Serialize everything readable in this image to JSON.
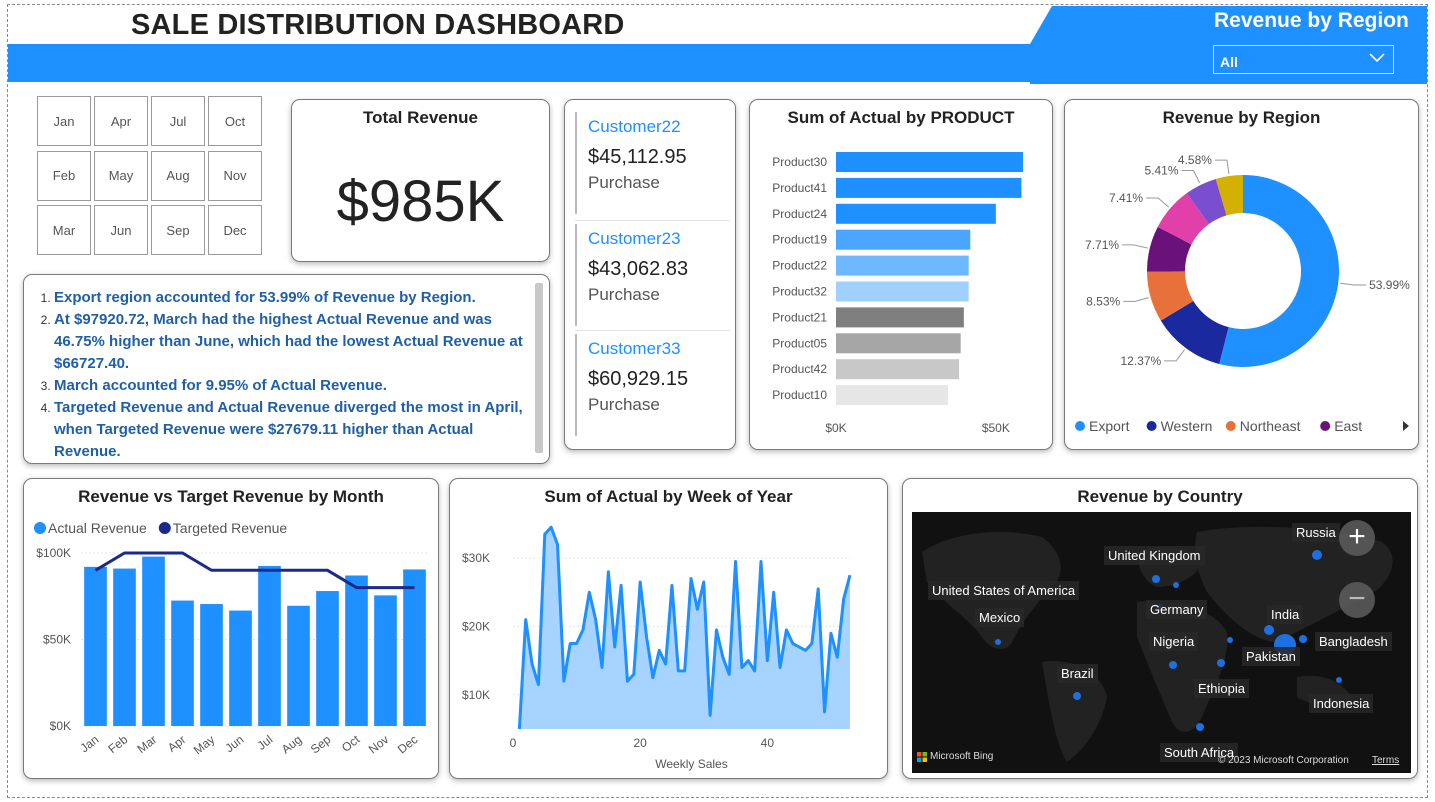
{
  "header": {
    "title": "SALE DISTRIBUTION DASHBOARD",
    "slicer_title": "Revenue by Region",
    "slicer_value": "All"
  },
  "months": [
    "Jan",
    "Apr",
    "Jul",
    "Oct",
    "Feb",
    "May",
    "Aug",
    "Nov",
    "Mar",
    "Jun",
    "Sep",
    "Dec"
  ],
  "total_revenue": {
    "title": "Total Revenue",
    "value": "$985K"
  },
  "narrative": [
    "Export region accounted for 53.99% of Revenue by Region.",
    "At $97920.72, March had the highest Actual Revenue and was 46.75% higher than June, which had the lowest Actual Revenue at $66727.40.",
    "March accounted for 9.95% of Actual Revenue.",
    "Targeted Revenue and Actual Revenue diverged the most in April, when Targeted Revenue were $27679.11 higher than Actual Revenue."
  ],
  "customers": [
    {
      "name": "Customer22",
      "value": "$45,112.95",
      "label": "Purchase"
    },
    {
      "name": "Customer23",
      "value": "$43,062.83",
      "label": "Purchase"
    },
    {
      "name": "Customer33",
      "value": "$60,929.15",
      "label": "Purchase"
    }
  ],
  "colors": {
    "accent": "#1e90ff",
    "navy": "#1a2a8a"
  },
  "chart_data": [
    {
      "id": "product",
      "type": "bar",
      "orientation": "horizontal",
      "title": "Sum of Actual by PRODUCT",
      "categories": [
        "Product30",
        "Product41",
        "Product24",
        "Product19",
        "Product22",
        "Product32",
        "Product21",
        "Product05",
        "Product42",
        "Product10"
      ],
      "values": [
        58500,
        58000,
        50000,
        42000,
        41500,
        41500,
        40000,
        39000,
        38500,
        35000
      ],
      "colors": [
        "#1e90ff",
        "#1e90ff",
        "#1e90ff",
        "#4aa6ff",
        "#6db8ff",
        "#9fd0ff",
        "#7f7f7f",
        "#a6a6a6",
        "#c8c8c8",
        "#e6e6e6"
      ],
      "xlim": [
        0,
        58500
      ],
      "xticks": [
        {
          "v": 0,
          "label": "$0K"
        },
        {
          "v": 50000,
          "label": "$50K"
        }
      ]
    },
    {
      "id": "region",
      "type": "pie",
      "title": "Revenue by Region",
      "labels": [
        "Export",
        "Western",
        "Northeast",
        "East",
        "",
        "",
        ""
      ],
      "values": [
        53.99,
        12.37,
        8.53,
        7.71,
        7.41,
        5.41,
        4.58
      ],
      "value_labels": [
        "53.99%",
        "12.37%",
        "8.53%",
        "7.71%",
        "7.41%",
        "5.41%",
        "4.58%"
      ],
      "colors": [
        "#1e90ff",
        "#1a2a9e",
        "#e8703a",
        "#6b127a",
        "#e040a8",
        "#7a4fcf",
        "#d4b000"
      ],
      "legend": [
        "Export",
        "Western",
        "Northeast",
        "East"
      ],
      "legend_position": "bottom"
    },
    {
      "id": "monthly",
      "type": "bar",
      "title": "Revenue vs Target Revenue by Month",
      "categories": [
        "Jan",
        "Feb",
        "Mar",
        "Apr",
        "May",
        "Jun",
        "Jul",
        "Aug",
        "Sep",
        "Oct",
        "Nov",
        "Dec"
      ],
      "series": [
        {
          "name": "Actual Revenue",
          "type": "bar",
          "values": [
            92000,
            91000,
            97920,
            72500,
            70500,
            66727,
            92500,
            69500,
            78000,
            87000,
            75500,
            90500
          ],
          "color": "#1e90ff"
        },
        {
          "name": "Targeted Revenue",
          "type": "line",
          "values": [
            90000,
            100000,
            100000,
            100000,
            90000,
            90000,
            90000,
            90000,
            90000,
            80000,
            80000,
            80000
          ],
          "color": "#1a2a8a"
        }
      ],
      "ylim": [
        0,
        100000
      ],
      "yticks": [
        {
          "v": 0,
          "label": "$0K"
        },
        {
          "v": 50000,
          "label": "$50K"
        },
        {
          "v": 100000,
          "label": "$100K"
        }
      ],
      "legend_position": "top-left"
    },
    {
      "id": "weekly",
      "type": "area",
      "title": "Sum of Actual by Week of Year",
      "xlabel": "Weekly Sales",
      "x": [
        1,
        2,
        3,
        4,
        5,
        6,
        7,
        8,
        9,
        10,
        11,
        12,
        13,
        14,
        15,
        16,
        17,
        18,
        19,
        20,
        21,
        22,
        23,
        24,
        25,
        26,
        27,
        28,
        29,
        30,
        31,
        32,
        33,
        34,
        35,
        36,
        37,
        38,
        39,
        40,
        41,
        42,
        43,
        44,
        45,
        46,
        47,
        48,
        49,
        50,
        51,
        52,
        53
      ],
      "y": [
        5000,
        21000,
        14500,
        11500,
        33500,
        34500,
        32000,
        12000,
        17500,
        17500,
        19500,
        25000,
        21000,
        14000,
        28000,
        17000,
        26000,
        12000,
        13000,
        26500,
        18500,
        12500,
        16500,
        14500,
        26000,
        13500,
        13500,
        27000,
        22500,
        26500,
        7000,
        19500,
        15500,
        13000,
        29500,
        14000,
        15000,
        13500,
        29500,
        15000,
        25000,
        14000,
        19500,
        17500,
        17000,
        16500,
        17500,
        25500,
        7500,
        19000,
        15500,
        24000,
        27500
      ],
      "xlim": [
        0,
        53
      ],
      "ylim": [
        5000,
        36000
      ],
      "xticks": [
        {
          "v": 0,
          "label": "0"
        },
        {
          "v": 20,
          "label": "20"
        },
        {
          "v": 40,
          "label": "40"
        }
      ],
      "yticks": [
        {
          "v": 10000,
          "label": "$10K"
        },
        {
          "v": 20000,
          "label": "$20K"
        },
        {
          "v": 30000,
          "label": "$30K"
        }
      ]
    }
  ],
  "map": {
    "title": "Revenue by Country",
    "countries": [
      "Russia",
      "United Kingdom",
      "United States of America",
      "Mexico",
      "Germany",
      "India",
      "Bangladesh",
      "Nigeria",
      "Pakistan",
      "Brazil",
      "Ethiopia",
      "Indonesia",
      "South Africa"
    ],
    "attribution": "Microsoft Bing",
    "copyright": "© 2023 Microsoft Corporation",
    "terms": "Terms",
    "zoom_in": "+",
    "zoom_out": "−"
  }
}
